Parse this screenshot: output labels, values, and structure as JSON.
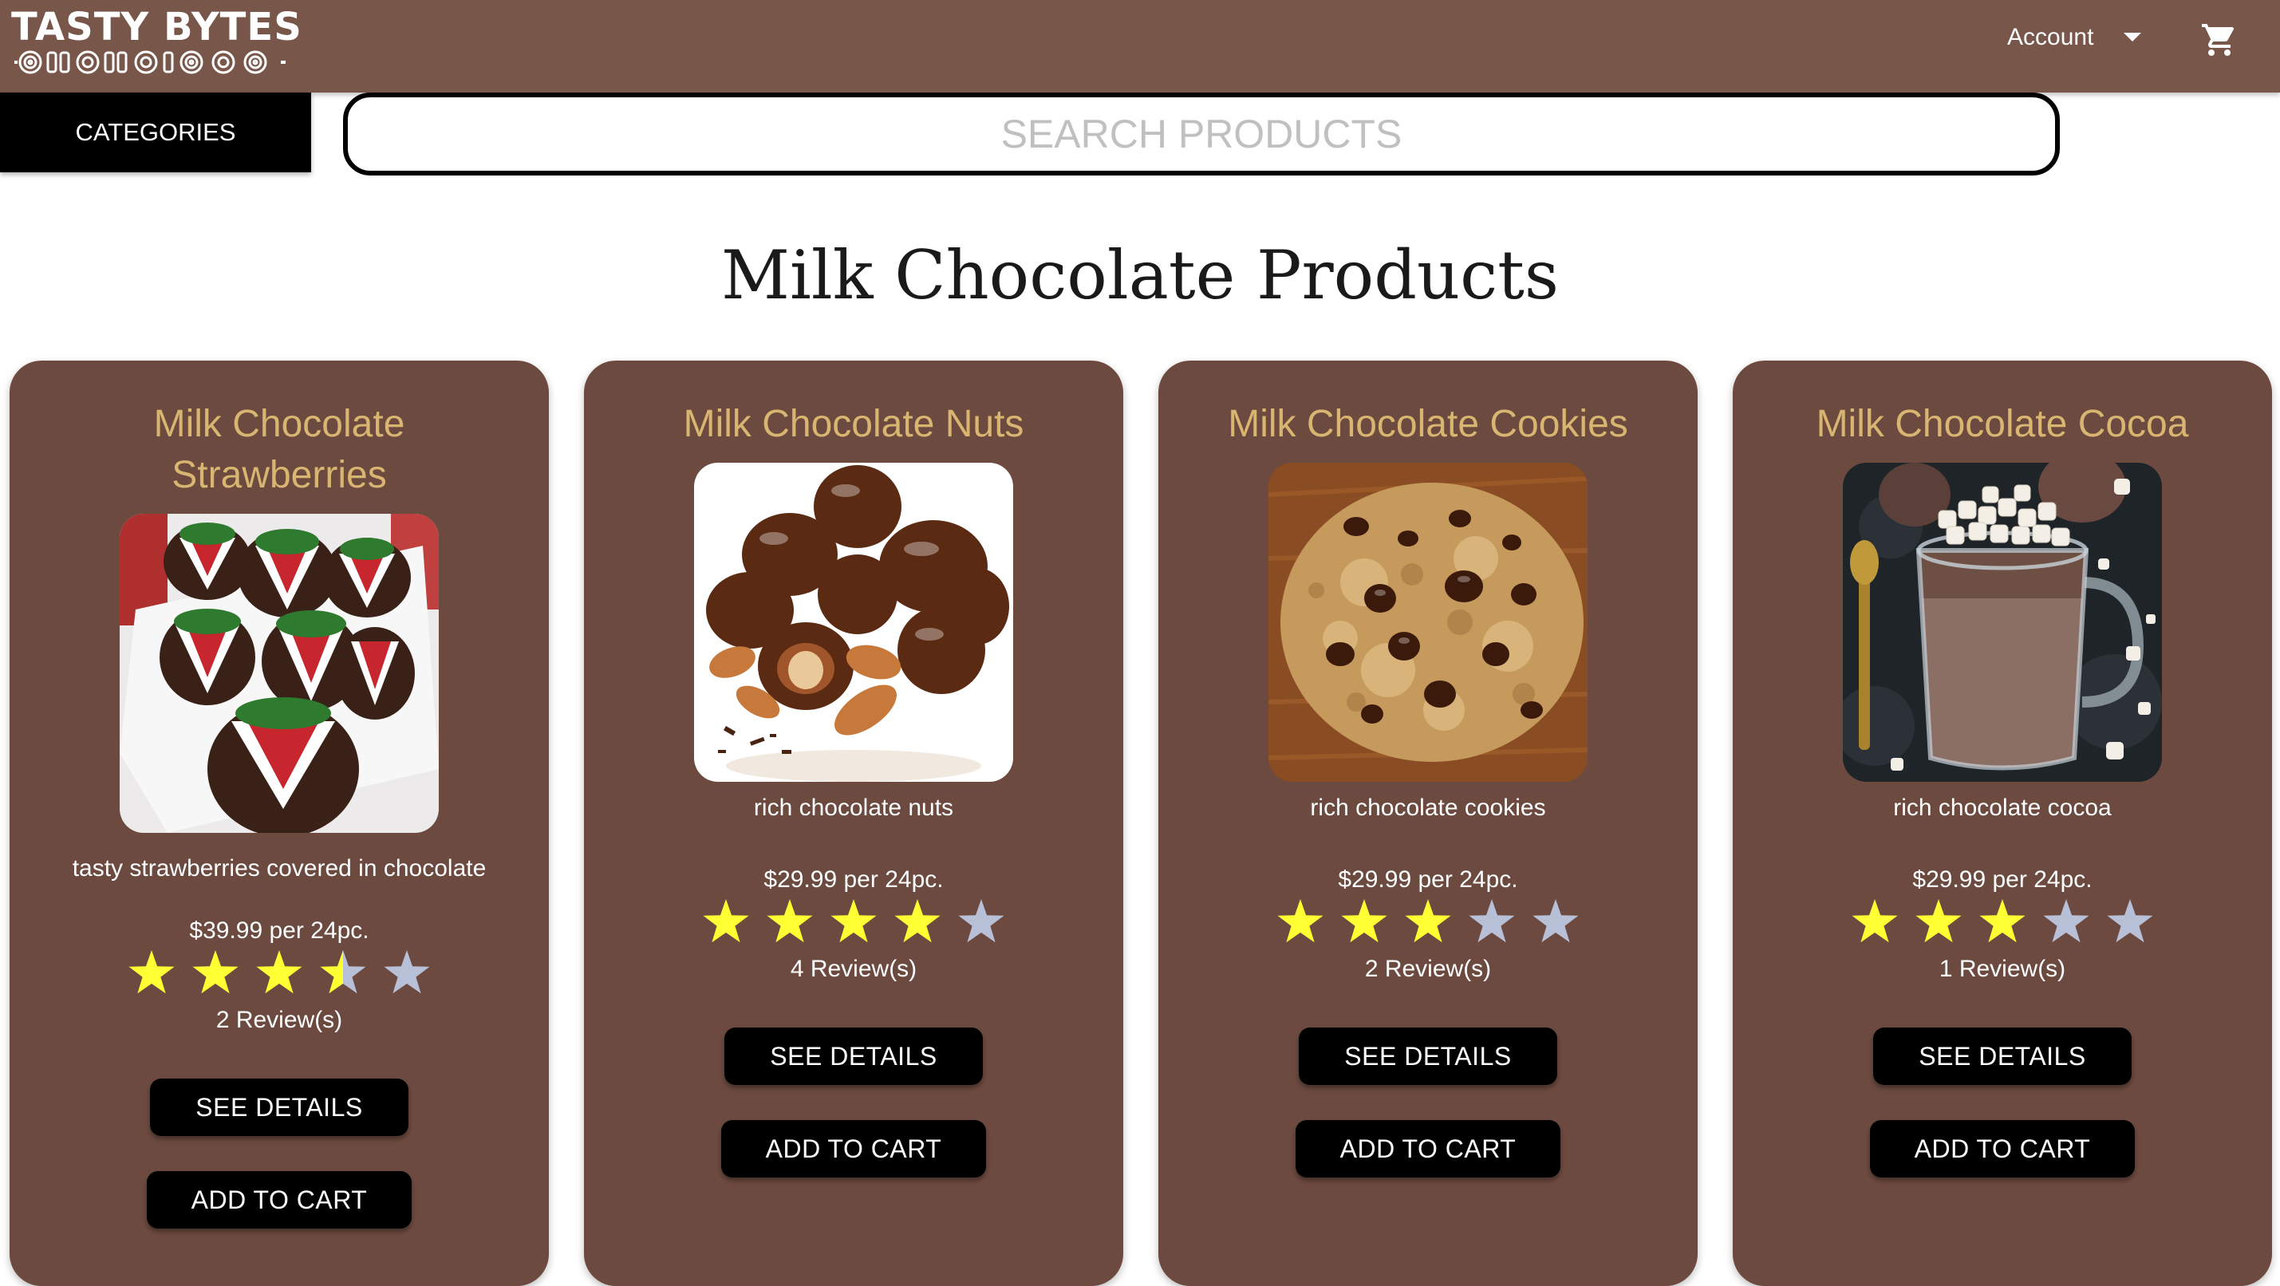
{
  "brand": {
    "logo_text": "TASTY BYTES"
  },
  "header": {
    "account_label": "Account"
  },
  "nav": {
    "categories_label": "CATEGORIES"
  },
  "search": {
    "placeholder": "SEARCH PRODUCTS",
    "value": ""
  },
  "page": {
    "title": "Milk Chocolate Products"
  },
  "colors": {
    "header_bg": "#785649",
    "card_bg": "#6c4a3f",
    "title_gold": "#d8b570",
    "star_filled": "#ffff33",
    "star_empty": "#b8c0d8"
  },
  "products": [
    {
      "title": "Milk Chocolate Strawberries",
      "description": "tasty strawberries covered in chocolate",
      "price": "$39.99 per 24pc.",
      "rating": 3.5,
      "reviews": "2 Review(s)",
      "details_label": "SEE DETAILS",
      "cart_label": "ADD TO CART",
      "image_icon": "chocolate-strawberries-image"
    },
    {
      "title": "Milk Chocolate Nuts",
      "description": "rich chocolate nuts",
      "price": "$29.99 per 24pc.",
      "rating": 4,
      "reviews": "4 Review(s)",
      "details_label": "SEE DETAILS",
      "cart_label": "ADD TO CART",
      "image_icon": "chocolate-nuts-image"
    },
    {
      "title": "Milk Chocolate Cookies",
      "description": "rich chocolate cookies",
      "price": "$29.99 per 24pc.",
      "rating": 3,
      "reviews": "2 Review(s)",
      "details_label": "SEE DETAILS",
      "cart_label": "ADD TO CART",
      "image_icon": "chocolate-cookie-image"
    },
    {
      "title": "Milk Chocolate Cocoa",
      "description": "rich chocolate cocoa",
      "price": "$29.99 per 24pc.",
      "rating": 3,
      "reviews": "1 Review(s)",
      "details_label": "SEE DETAILS",
      "cart_label": "ADD TO CART",
      "image_icon": "hot-cocoa-image"
    }
  ]
}
